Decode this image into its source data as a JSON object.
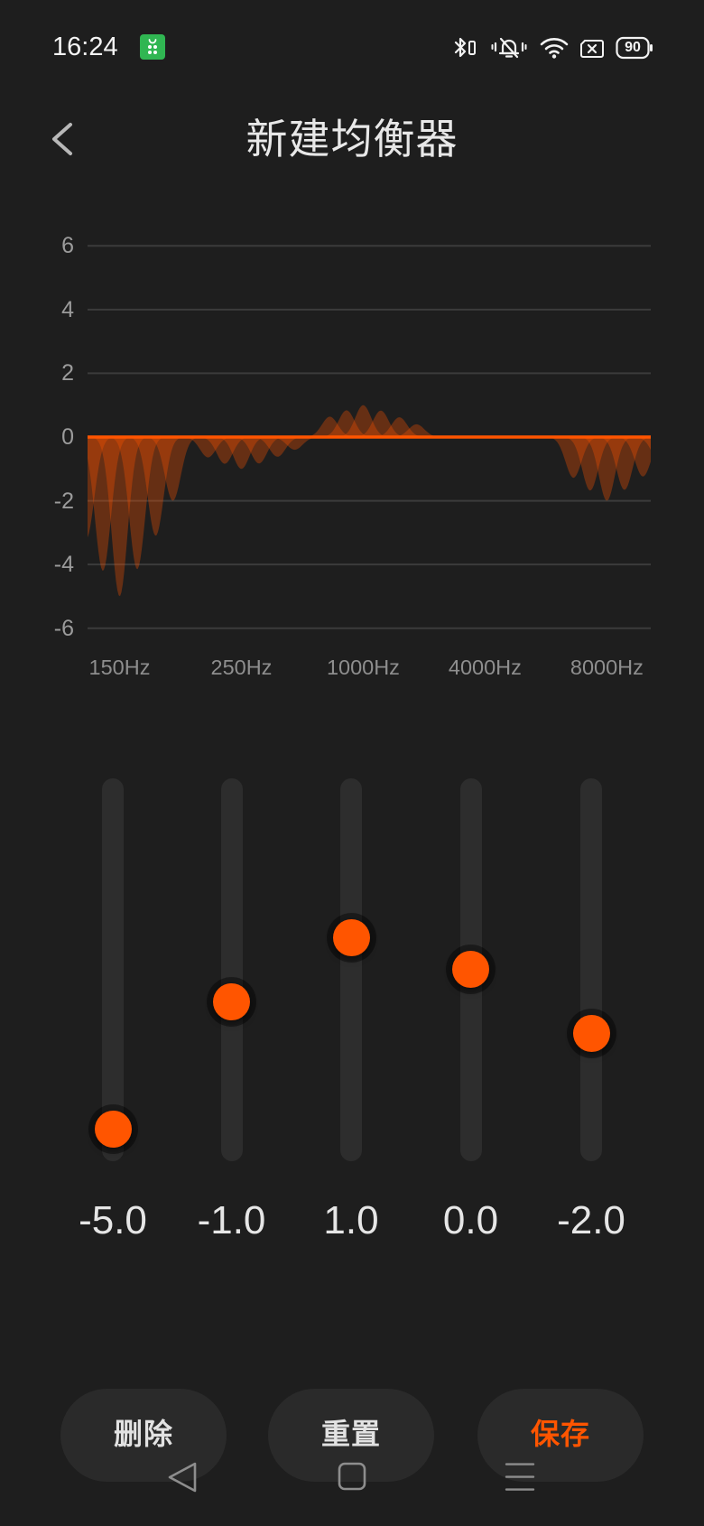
{
  "colors": {
    "background": "#1e1e1e",
    "accent": "#ff5500",
    "app_icon": "#30b652"
  },
  "status_bar": {
    "time": "16:24",
    "left_icons": [
      "app-store-icon"
    ],
    "right_icons": [
      "bluetooth-icon",
      "silent-mode-icon",
      "wifi-icon",
      "no-sim-icon",
      "battery-icon"
    ],
    "battery_level": "90"
  },
  "header": {
    "back_icon": "chevron-left-icon",
    "title": "新建均衡器"
  },
  "chart_data": {
    "type": "area",
    "categories": [
      "150Hz",
      "250Hz",
      "1000Hz",
      "4000Hz",
      "8000Hz"
    ],
    "values": [
      -5,
      -1,
      1,
      0,
      -2
    ],
    "yticks": [
      6,
      4,
      2,
      0,
      -2,
      -4,
      -6
    ],
    "ylim": [
      -6,
      6
    ],
    "grid": true
  },
  "equalizer": {
    "range": [
      -6,
      6
    ],
    "sliders": [
      {
        "value": -5,
        "label": "-5.0"
      },
      {
        "value": -1,
        "label": "-1.0"
      },
      {
        "value": 1,
        "label": "1.0"
      },
      {
        "value": 0,
        "label": "0.0"
      },
      {
        "value": -2,
        "label": "-2.0"
      }
    ]
  },
  "actions": {
    "delete_label": "删除",
    "reset_label": "重置",
    "save_label": "保存"
  },
  "nav_bar": {
    "icons": [
      "nav-back-icon",
      "nav-home-icon",
      "nav-menu-icon"
    ]
  }
}
